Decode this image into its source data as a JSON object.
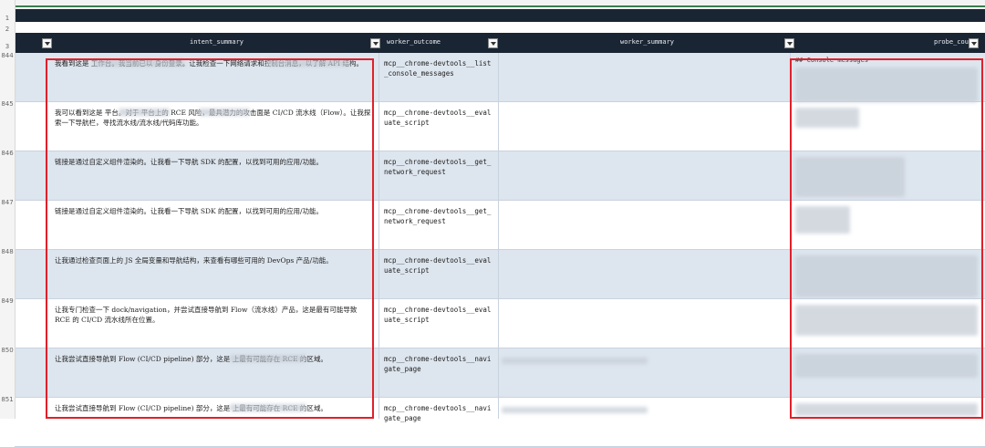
{
  "sheet": {
    "top_row_numbers": [
      "1",
      "2",
      "3"
    ],
    "columns": {
      "intent_summary": "intent_summary",
      "worker_outcome": "worker_outcome",
      "worker_summary": "worker_summary",
      "probe_count": "probe_count"
    },
    "rows": [
      {
        "num": "844",
        "intent": "我看到这是                                        工作台。我当前已以                       身份登录。让我检查一下网络请求和控制台消息，以了解 API 结构。",
        "outcome": "mcp__chrome-devtools__list_console_messages"
      },
      {
        "num": "845",
        "intent": "我可以看到这是              平台。对于              平台上的 RCE 风险，最具潜力的攻击面是 CI/CD 流水线（Flow）。让我探索一下导航栏，寻找流水线/流水线/代码库功能。",
        "outcome": "mcp__chrome-devtools__evaluate_script"
      },
      {
        "num": "846",
        "intent": "链接是通过自定义组件渲染的。让我看一下导航 SDK 的配置，以找到可用的应用/功能。",
        "outcome": "mcp__chrome-devtools__get_network_request"
      },
      {
        "num": "847",
        "intent": "链接是通过自定义组件渲染的。让我看一下导航 SDK 的配置，以找到可用的应用/功能。",
        "outcome": "mcp__chrome-devtools__get_network_request"
      },
      {
        "num": "848",
        "intent": "让我通过检查页面上的 JS 全局变量和导航结构，来查看有哪些可用的 DevOps 产品/功能。",
        "outcome": "mcp__chrome-devtools__evaluate_script"
      },
      {
        "num": "849",
        "intent": "让我专门检查一下 dock/navigation，并尝试直接导航到 Flow（流水线）产品，这是最有可能导致 RCE 的 CI/CD 流水线所在位置。",
        "outcome": "mcp__chrome-devtools__evaluate_script"
      },
      {
        "num": "850",
        "intent": "让我尝试直接导航到 Flow (CI/CD pipeline) 部分，这是                        上最有可能存在 RCE 的区域。",
        "outcome": "mcp__chrome-devtools__navigate_page"
      },
      {
        "num": "851",
        "intent": "让我尝试直接导航到 Flow (CI/CD pipeline) 部分，这是                        上最有可能存在 RCE 的区域。",
        "outcome": "mcp__chrome-devtools__navigate_page"
      }
    ],
    "probe_first_line": "## Console messages"
  },
  "colors": {
    "header_bg": "#1a2533",
    "row_alt_bg": "#dde5ee",
    "highlight_box": "#e0202a",
    "frozen_line": "#3b7d4f"
  }
}
